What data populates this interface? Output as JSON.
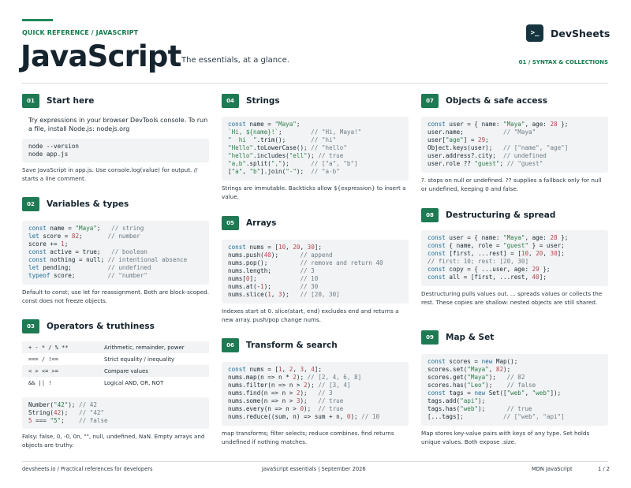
{
  "header": {
    "eyebrow": "QUICK REFERENCE / JAVASCRIPT",
    "title": "JavaScript",
    "tagline": "The essentials, at a glance.",
    "brand_logo": ">_",
    "brand_name": "DevSheets",
    "section_tag": "01 / SYNTAX & COLLECTIONS"
  },
  "colors": {
    "accent": "#1e8a5b",
    "badge": "#1e7a53",
    "code_bg": "#f1f3f4",
    "brand_dark": "#15343f"
  },
  "sections": {
    "s01": {
      "num": "01",
      "title": "Start here",
      "intro": "Try expressions in your browser DevTools console. To run a file, install Node.js: nodejs.org",
      "code": [
        "node --version",
        "node app.js"
      ],
      "note": "Save JavaScript in app.js. Use console.log(value) for output. // starts a line comment."
    },
    "s02": {
      "num": "02",
      "title": "Variables & types",
      "code": [
        "const name = \"Maya\";   // string",
        "let score = 82;       // number",
        "score += 1;",
        "const active = true;   // boolean",
        "const nothing = null; // intentional absence",
        "let pending;          // undefined",
        "typeof score;         // \"number\""
      ],
      "note": "Default to const; use let for reassignment. Both are block-scoped. const does not freeze objects."
    },
    "s03": {
      "num": "03",
      "title": "Operators & truthiness",
      "operators": [
        {
          "sym": "+ - * / % **",
          "desc": "Arithmetic, remainder, power"
        },
        {
          "sym": "=== / !==",
          "desc": "Strict equality / inequality"
        },
        {
          "sym": "< > <= >=",
          "desc": "Compare values"
        },
        {
          "sym": "&& || !",
          "desc": "Logical AND, OR, NOT"
        }
      ],
      "code": [
        "Number(\"42\"); // 42",
        "String(42);   // \"42\"",
        "5 === \"5\";    // false"
      ],
      "note": "Falsy: false, 0, -0, 0n, \"\", null, undefined, NaN. Empty arrays and objects are truthy."
    },
    "s04": {
      "num": "04",
      "title": "Strings",
      "code": [
        "const name = \"Maya\";",
        "`Hi, ${name}!`;        // \"Hi, Maya!\"",
        "\"  hi  \".trim();       // \"hi\"",
        "\"Hello\".toLowerCase(); // \"hello\"",
        "\"hello\".includes(\"ell\"); // true",
        "\"a,b\".split(\",\");      // [\"a\", \"b\"]",
        "[\"a\", \"b\"].join(\"-\");  // \"a-b\""
      ],
      "note": "Strings are immutable. Backticks allow ${expression} to insert a value."
    },
    "s05": {
      "num": "05",
      "title": "Arrays",
      "code": [
        "const nums = [10, 20, 30];",
        "nums.push(40);      // append",
        "nums.pop();         // remove and return 40",
        "nums.length;        // 3",
        "nums[0];            // 10",
        "nums.at(-1);        // 30",
        "nums.slice(1, 3);   // [20, 30]"
      ],
      "note": "Indexes start at 0. slice(start, end) excludes end and returns a new array. push/pop change nums."
    },
    "s06": {
      "num": "06",
      "title": "Transform & search",
      "code": [
        "const nums = [1, 2, 3, 4];",
        "nums.map(n => n * 2); // [2, 4, 6, 8]",
        "nums.filter(n => n > 2); // [3, 4]",
        "nums.find(n => n > 2);   // 3",
        "nums.some(n => n > 3);   // true",
        "nums.every(n => n > 0);  // true",
        "nums.reduce((sum, n) => sum + n, 0); // 10"
      ],
      "note": "map transforms; filter selects; reduce combines. find returns undefined if nothing matches."
    },
    "s07": {
      "num": "07",
      "title": "Objects & safe access",
      "code": [
        "const user = { name: \"Maya\", age: 28 };",
        "user.name;           // \"Maya\"",
        "user[\"age\"] = 29;",
        "Object.keys(user);   // [\"name\", \"age\"]",
        "user.address?.city;  // undefined",
        "user.role ?? \"guest\"; // \"guest\""
      ],
      "note": "?. stops on null or undefined. ?? supplies a fallback only for null or undefined, keeping 0 and false."
    },
    "s08": {
      "num": "08",
      "title": "Destructuring & spread",
      "code": [
        "const user = { name: \"Maya\", age: 28 };",
        "const { name, role = \"guest\" } = user;",
        "const [first, ...rest] = [10, 20, 30];",
        "// first: 10; rest: [20, 30]",
        "const copy = { ...user, age: 29 };",
        "const all = [first, ...rest, 40];"
      ],
      "note": "Destructuring pulls values out. ... spreads values or collects the rest. These copies are shallow: nested objects are still shared."
    },
    "s09": {
      "num": "09",
      "title": "Map & Set",
      "code": [
        "const scores = new Map();",
        "scores.set(\"Maya\", 82);",
        "scores.get(\"Maya\");   // 82",
        "scores.has(\"Leo\");    // false",
        "const tags = new Set([\"web\", \"web\"]);",
        "tags.add(\"api\");",
        "tags.has(\"web\");      // true",
        "[...tags];           // [\"web\", \"api\"]"
      ],
      "note": "Map stores key-value pairs with keys of any type. Set holds unique values. Both expose .size."
    }
  },
  "footer": {
    "left": "devsheets.io  /  Practical references for developers",
    "center": "JavaScript essentials  |  September 2026",
    "right": "MDN JavaScript",
    "page": "1 / 2"
  }
}
